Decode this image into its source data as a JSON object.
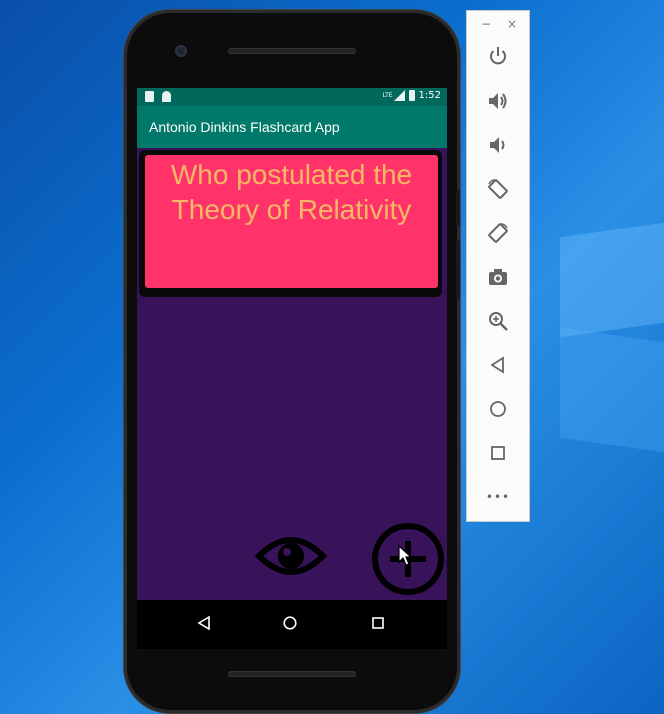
{
  "app": {
    "title": "Antonio Dinkins Flashcard App"
  },
  "status_bar": {
    "time": "1:52",
    "network": "LTE"
  },
  "flashcard": {
    "question": "Who postulated the Theory of Relativity"
  },
  "actions": {
    "toggle_answer_icon": "eye-icon",
    "add_card_icon": "plus-icon"
  },
  "android_nav": [
    "back",
    "home",
    "recents"
  ],
  "emulator_toolbar": {
    "window_controls": [
      "−",
      "×"
    ],
    "tools": [
      "power",
      "volume-up",
      "volume-down",
      "rotate-left",
      "rotate-right",
      "screenshot",
      "zoom",
      "back",
      "home",
      "overview",
      "more"
    ],
    "more_label": "•••"
  },
  "colors": {
    "app_bar": "#00796b",
    "status_bar": "#00695c",
    "content_bg": "#38135a",
    "card_bg": "#ff3369",
    "card_text": "#f7b865"
  }
}
